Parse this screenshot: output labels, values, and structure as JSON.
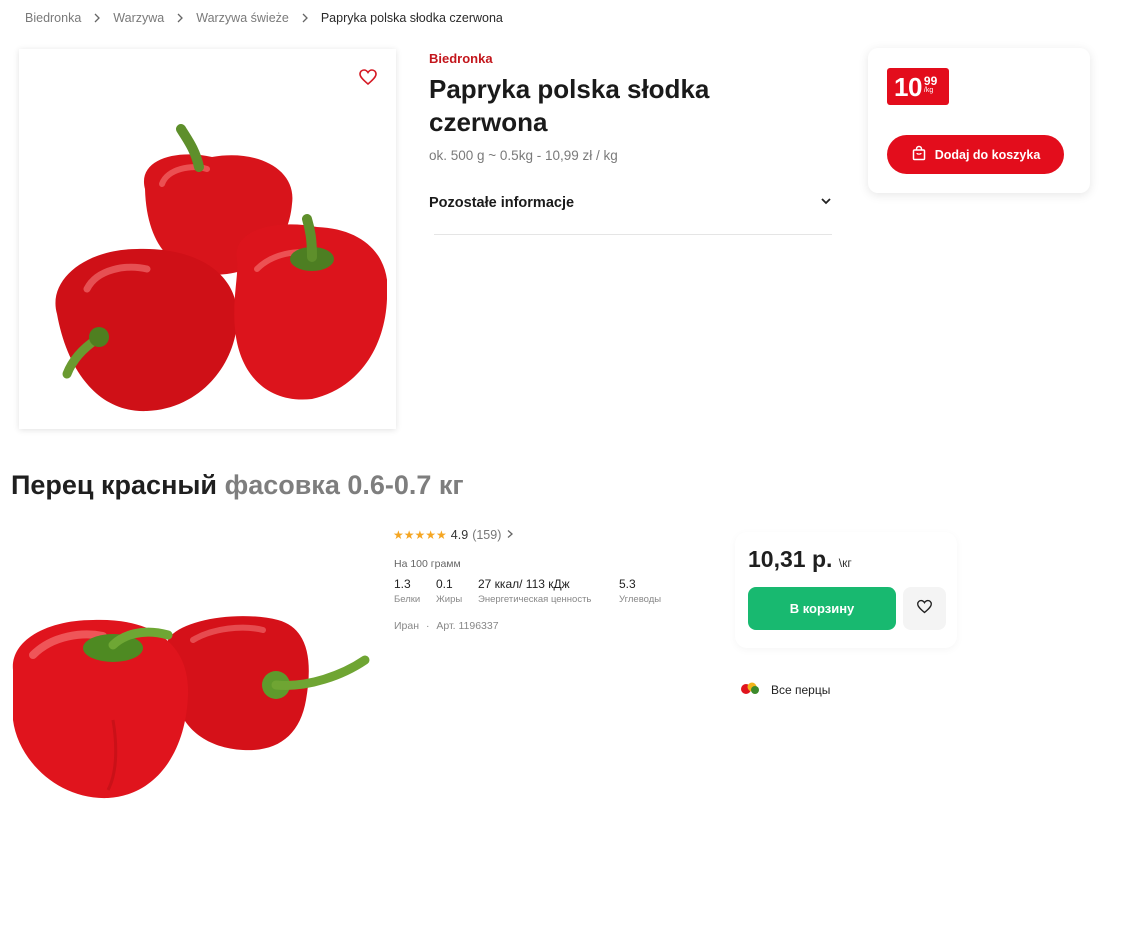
{
  "breadcrumb": [
    "Biedronka",
    "Warzywa",
    "Warzywa świeże",
    "Papryka polska słodka czerwona"
  ],
  "biedronka": {
    "brand": "Biedronka",
    "title": "Papryka polska słodka czerwona",
    "weight_info": "ok. 500 g ~ 0.5kg - 10,99 zł / kg",
    "info_toggle": "Pozostałe informacje",
    "price": {
      "integer": "10",
      "decimal": "99",
      "unit": "/kg"
    },
    "add_to_cart": "Dodaj do koszyka",
    "accent_color": "#e30d1c"
  },
  "russian": {
    "title_main": "Перец красный",
    "title_pack": "фасовка 0.6-0.7 кг",
    "rating": {
      "stars": "★★★★★",
      "value": "4.9",
      "count": "(159)",
      "stars_filled": 5
    },
    "per_100": "На 100 грамм",
    "nutrition": [
      {
        "value": "1.3",
        "label": "Белки"
      },
      {
        "value": "0.1",
        "label": "Жиры"
      },
      {
        "value": "27 ккал/ 113 кДж",
        "label": "Энергетическая ценность"
      },
      {
        "value": "5.3",
        "label": "Углеводы"
      }
    ],
    "country": "Иран",
    "article": "Арт. 1196337",
    "price": "10,31 р.",
    "price_unit": "\\кг",
    "add_to_cart": "В корзину",
    "all_link": "Все перцы",
    "accent_color": "#18b970"
  }
}
